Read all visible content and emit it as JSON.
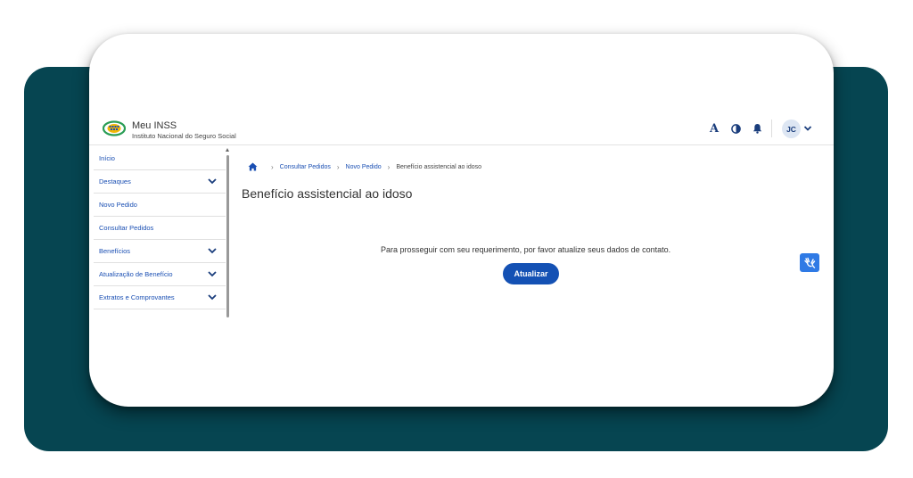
{
  "header": {
    "app_title": "Meu INSS",
    "app_subtitle": "Instituto Nacional do Seguro Social",
    "font_size_label": "A",
    "avatar_initials": "JC"
  },
  "sidebar": {
    "items": [
      {
        "label": "Início",
        "has_chevron": false
      },
      {
        "label": "Destaques",
        "has_chevron": true
      },
      {
        "label": "Novo Pedido",
        "has_chevron": false
      },
      {
        "label": "Consultar Pedidos",
        "has_chevron": false
      },
      {
        "label": "Benefícios",
        "has_chevron": true
      },
      {
        "label": "Atualização de Benefício",
        "has_chevron": true
      },
      {
        "label": "Extratos e Comprovantes",
        "has_chevron": true
      }
    ]
  },
  "breadcrumb": {
    "items": [
      "Consultar Pedidos",
      "Novo Pedido",
      "Benefício assistencial ao idoso"
    ]
  },
  "main": {
    "title": "Benefício assistencial ao idoso",
    "message": "Para prosseguir com seu requerimento, por favor atualize seus dados de contato.",
    "update_button": "Atualizar"
  },
  "colors": {
    "background_card": "#064551",
    "primary": "#1451b4",
    "link": "#1a4fb3",
    "icon": "#1a3d7c",
    "accessibility_button": "#2f7ae5"
  }
}
